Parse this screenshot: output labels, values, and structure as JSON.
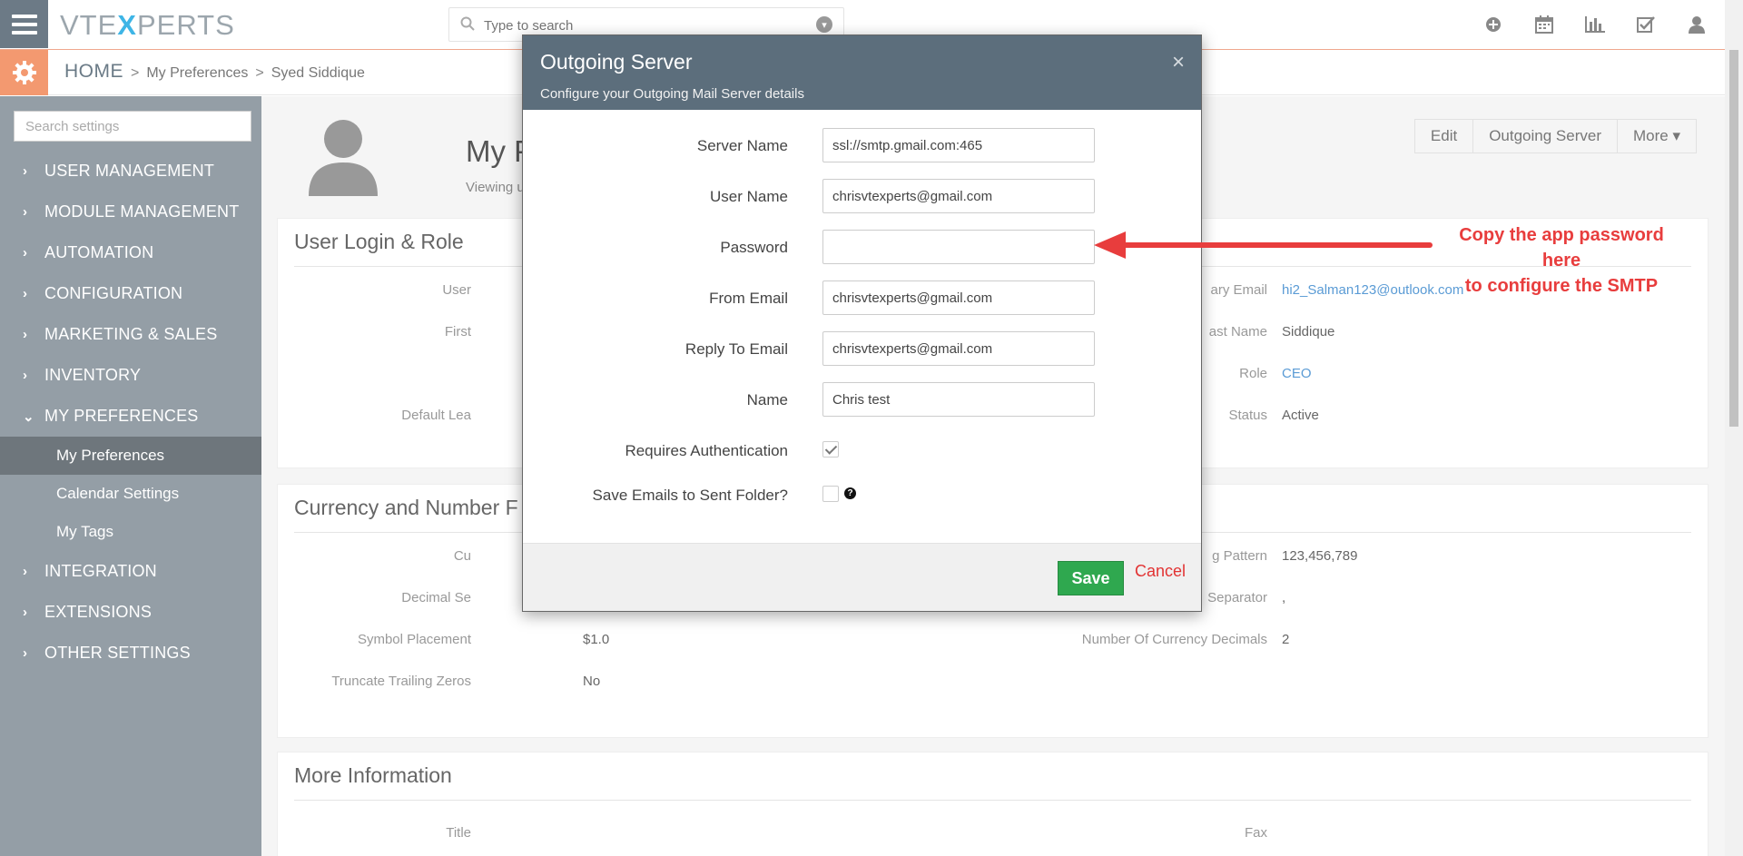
{
  "app": {
    "logo_left": "VTE",
    "logo_x": "X",
    "logo_right": "PERTS",
    "search_placeholder": "Type to search"
  },
  "breadcrumb": {
    "home": "HOME",
    "sep1": ">",
    "item1": "My Preferences",
    "sep2": ">",
    "item2": "Syed Siddique"
  },
  "sidebar": {
    "search_placeholder": "Search settings",
    "items": [
      {
        "label": "USER MANAGEMENT",
        "chev": "›"
      },
      {
        "label": "MODULE MANAGEMENT",
        "chev": "›"
      },
      {
        "label": "AUTOMATION",
        "chev": "›"
      },
      {
        "label": "CONFIGURATION",
        "chev": "›"
      },
      {
        "label": "MARKETING & SALES",
        "chev": "›"
      },
      {
        "label": "INVENTORY",
        "chev": "›"
      },
      {
        "label": "MY PREFERENCES",
        "chev": "⌄"
      }
    ],
    "subitems": [
      "My Preferences",
      "Calendar Settings",
      "My Tags"
    ],
    "items_after": [
      {
        "label": "INTEGRATION",
        "chev": "›"
      },
      {
        "label": "EXTENSIONS",
        "chev": "›"
      },
      {
        "label": "OTHER SETTINGS",
        "chev": "›"
      }
    ]
  },
  "page": {
    "title_partial": "My P",
    "subtitle_partial": "Viewing u",
    "buttons": {
      "edit": "Edit",
      "outgoing": "Outgoing Server",
      "more": "More ▾"
    }
  },
  "user_login": {
    "heading": "User Login & Role",
    "left_labels": [
      "User",
      "First",
      "Default Lea"
    ],
    "right_labels": [
      "ary Email",
      "ast Name",
      "Role",
      "Status"
    ],
    "right_values": [
      "hi2_Salman123@outlook.com",
      "Siddique",
      "CEO",
      "Active"
    ]
  },
  "currency": {
    "heading": "Currency and Number F",
    "left_labels": [
      "Cu",
      "Decimal Se",
      "Symbol Placement",
      "Truncate Trailing Zeros"
    ],
    "left_values": [
      "",
      "",
      "$1.0",
      "No"
    ],
    "right_labels": [
      "g Pattern",
      "Separator",
      "Number Of Currency Decimals"
    ],
    "right_values": [
      "123,456,789",
      ",",
      "2"
    ]
  },
  "more_info": {
    "heading": "More Information",
    "left_label": "Title",
    "right_label": "Fax"
  },
  "modal": {
    "title": "Outgoing Server",
    "subtitle": "Configure your Outgoing Mail Server details",
    "close": "×",
    "fields": {
      "server_name": {
        "label": "Server Name",
        "value": "ssl://smtp.gmail.com:465"
      },
      "user_name": {
        "label": "User Name",
        "value": "chrisvtexperts@gmail.com"
      },
      "password": {
        "label": "Password",
        "value": ""
      },
      "from_email": {
        "label": "From Email",
        "value": "chrisvtexperts@gmail.com"
      },
      "reply_to": {
        "label": "Reply To Email",
        "value": "chrisvtexperts@gmail.com"
      },
      "name": {
        "label": "Name",
        "value": "Chris test"
      },
      "requires_auth": {
        "label": "Requires Authentication",
        "checked": true
      },
      "save_sent": {
        "label": "Save Emails to Sent Folder?",
        "checked": false
      }
    },
    "help_glyph": "?",
    "save": "Save",
    "cancel": "Cancel"
  },
  "annotation": {
    "line1": "Copy the app password here",
    "line2": "to configure the SMTP",
    "color": "#e83d3d"
  },
  "colors": {
    "sidebar_bg": "#949ea6",
    "modal_header": "#5c6e7c",
    "save_green": "#2fa84f",
    "accent_orange": "#f39970",
    "link_blue": "#5a9bd5"
  }
}
